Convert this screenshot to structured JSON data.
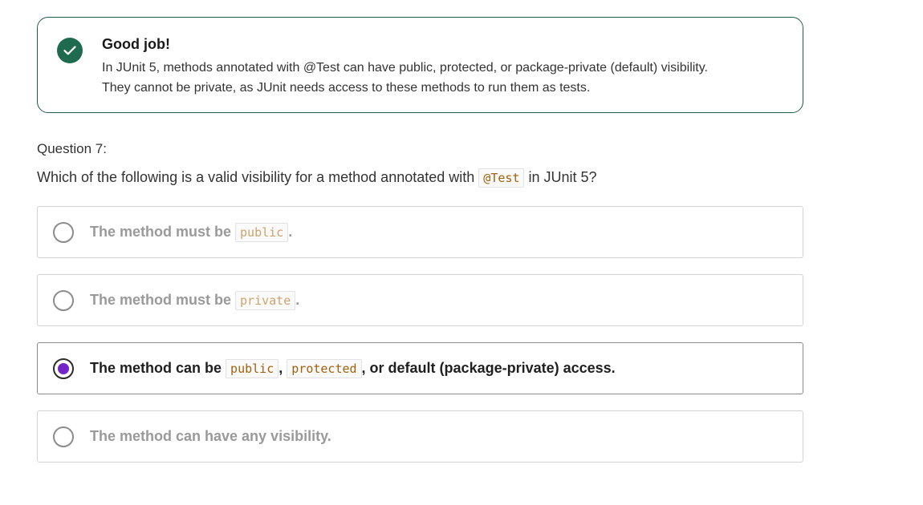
{
  "feedback": {
    "title": "Good job!",
    "line1": "In JUnit 5, methods annotated with @Test can have public, protected, or package-private (default) visibility.",
    "line2": "They cannot be private, as JUnit needs access to these methods to run them as tests.",
    "icon": "check-icon",
    "color": "#1f6b4f"
  },
  "question": {
    "label": "Question 7:",
    "text_before": "Which of the following is a valid visibility for a method annotated with",
    "code": "@Test",
    "text_after": "in JUnit 5?"
  },
  "options": [
    {
      "prefix": "The method must be",
      "code1": "public",
      "suffix": ".",
      "selected": false
    },
    {
      "prefix": "The method must be",
      "code1": "private",
      "suffix": ".",
      "selected": false
    },
    {
      "prefix": "The method can be",
      "code1": "public",
      "sep": ",",
      "code2": "protected",
      "suffix": ", or default (package-private) access.",
      "selected": true
    },
    {
      "prefix": "The method can have any visibility.",
      "selected": false
    }
  ],
  "colors": {
    "accent": "#7424c9",
    "success": "#1f6b4f",
    "code": "#a45f0a"
  }
}
